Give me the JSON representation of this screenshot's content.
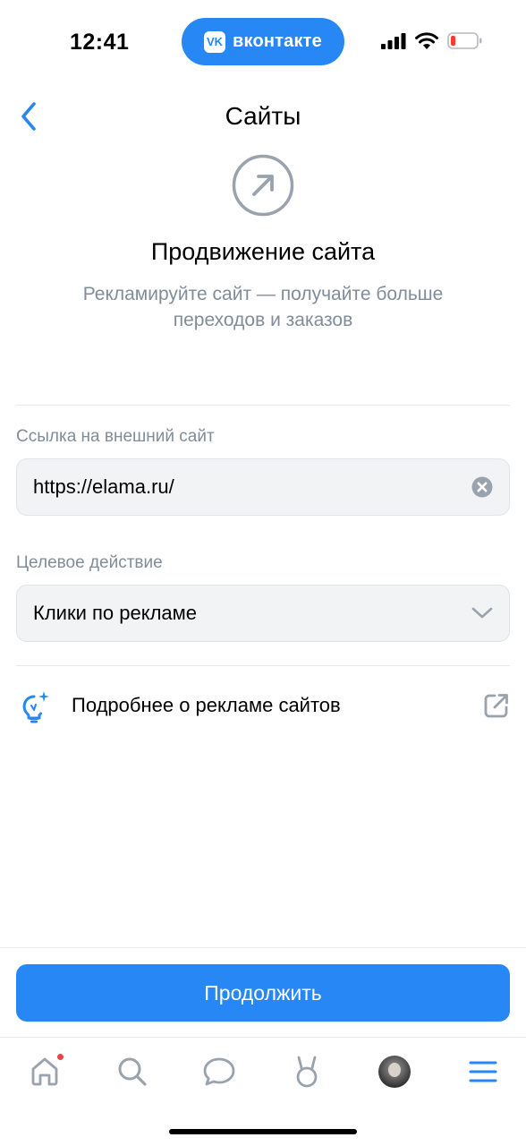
{
  "status_bar": {
    "time": "12:41",
    "app_pill_text": "вконтакте",
    "app_pill_logo": "VK",
    "icons": [
      "cellular-signal-icon",
      "wifi-icon",
      "battery-low-icon"
    ]
  },
  "header": {
    "title": "Сайты",
    "back_icon": "chevron-left-icon"
  },
  "promo": {
    "icon": "arrow-up-right-circle-icon",
    "title": "Продвижение сайта",
    "subtitle": "Рекламируйте сайт — получайте больше переходов и заказов"
  },
  "form": {
    "link_label": "Ссылка на внешний сайт",
    "link_value": "https://elama.ru/",
    "action_label": "Целевое действие",
    "action_value": "Клики по рекламе"
  },
  "info_link": {
    "text": "Подробнее о рекламе сайтов",
    "icon": "lightbulb-sparkle-icon",
    "external_icon": "external-link-icon"
  },
  "continue_button": "Продолжить",
  "tabbar": {
    "items": [
      "home-icon",
      "search-icon",
      "messages-icon",
      "clips-icon",
      "profile-avatar",
      "menu-icon"
    ],
    "home_has_badge": true
  },
  "colors": {
    "accent": "#2787f5",
    "secondary_text": "#818c99",
    "field_bg": "#f2f3f5",
    "badge": "#e64646"
  }
}
